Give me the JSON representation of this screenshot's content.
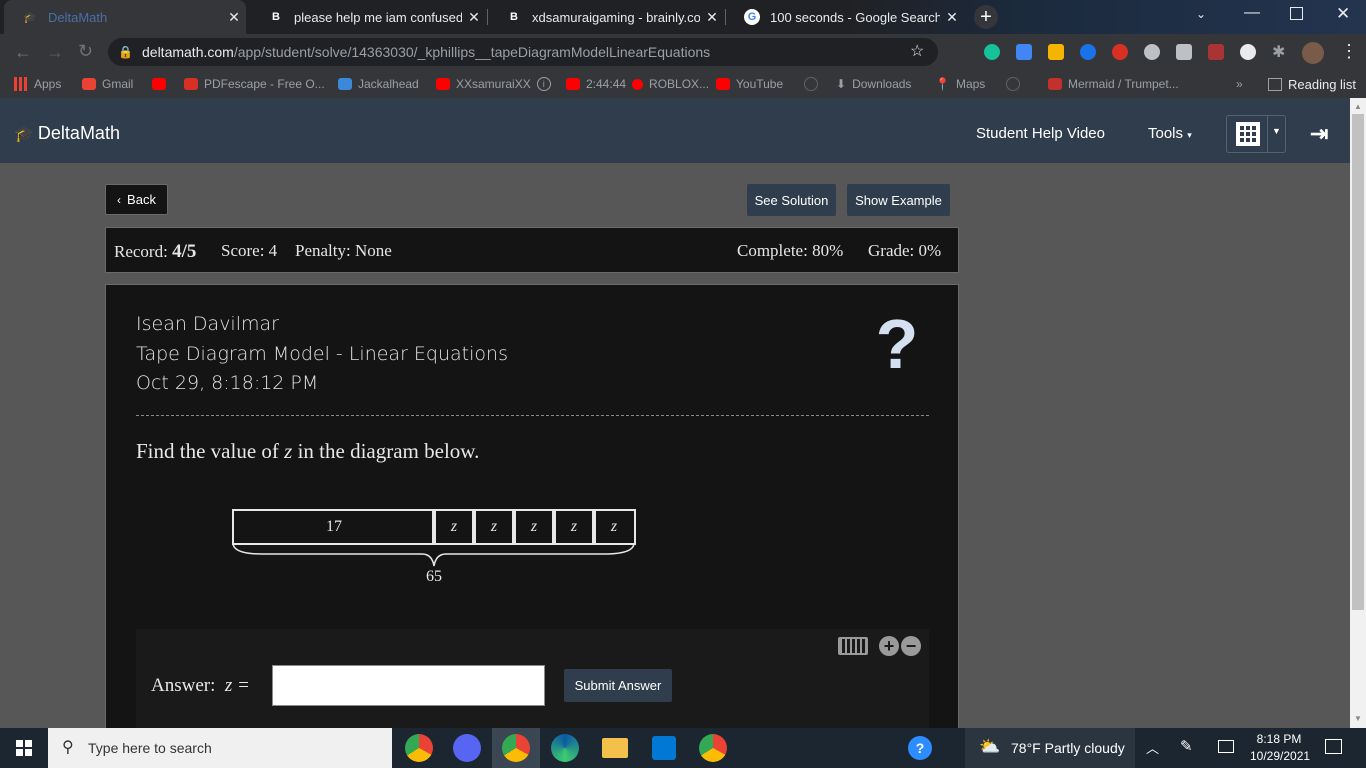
{
  "browser": {
    "tabs": [
      {
        "title": "DeltaMath",
        "favicon": "deltamath-icon",
        "active": true
      },
      {
        "title": "please help me iam confused - Br",
        "favicon": "brainly-icon",
        "active": false
      },
      {
        "title": "xdsamuraigaming - brainly.com",
        "favicon": "brainly-icon",
        "active": false
      },
      {
        "title": "100 seconds - Google Search",
        "favicon": "google-icon",
        "active": false
      }
    ],
    "new_tab": "+",
    "address": {
      "domain": "deltamath.com",
      "path": "/app/student/solve/14363030/_kphillips__tapeDiagramModelLinearEquations"
    },
    "bookmarks": [
      {
        "label": "Apps",
        "color": "#e94235"
      },
      {
        "label": "Gmail",
        "color": "#ea4335"
      },
      {
        "label": "",
        "color": "#ff0000"
      },
      {
        "label": "PDFescape - Free O...",
        "color": "#d93025"
      },
      {
        "label": "Jackalhead",
        "color": "#3b8ad9"
      },
      {
        "label": "XXsamuraiXX",
        "color": "#ff0000"
      },
      {
        "label": "2:44:44",
        "color": "#ff0000"
      },
      {
        "label": "ROBLOX...",
        "color": "#ff0000"
      },
      {
        "label": "YouTube",
        "color": "#ff0000"
      },
      {
        "label": "",
        "color": "#5f6368"
      },
      {
        "label": "Downloads",
        "color": "#9aa0a6"
      },
      {
        "label": "Maps",
        "color": "#34a853"
      },
      {
        "label": "",
        "color": "#5f6368"
      },
      {
        "label": "Mermaid / Trumpet...",
        "color": "#c4302b"
      }
    ],
    "reading_list": "Reading list",
    "more": "»"
  },
  "app": {
    "logo": "DeltaMath",
    "nav": {
      "help_video": "Student Help Video",
      "tools": "Tools"
    }
  },
  "actions": {
    "back": "Back",
    "see_solution": "See Solution",
    "show_example": "Show Example"
  },
  "record": {
    "record_label": "Record:",
    "record_value": "4/5",
    "score": "Score: 4",
    "penalty": "Penalty: None",
    "complete": "Complete: 80%",
    "grade": "Grade: 0%"
  },
  "problem": {
    "student": "Isean Davilmar",
    "title": "Tape Diagram Model - Linear Equations",
    "timestamp": "Oct 29, 8:18:12 PM",
    "help_icon": "?",
    "prompt_pre": "Find the value of",
    "prompt_var": "z",
    "prompt_post": "in the diagram below.",
    "tape": {
      "first": "17",
      "parts": [
        "z",
        "z",
        "z",
        "z",
        "z"
      ],
      "total": "65"
    },
    "answer_label": "Answer:",
    "answer_var": "z =",
    "answer_value": "",
    "submit": "Submit Answer"
  },
  "taskbar": {
    "search_placeholder": "Type here to search",
    "weather": "78°F  Partly cloudy",
    "time": "8:18 PM",
    "date": "10/29/2021"
  }
}
